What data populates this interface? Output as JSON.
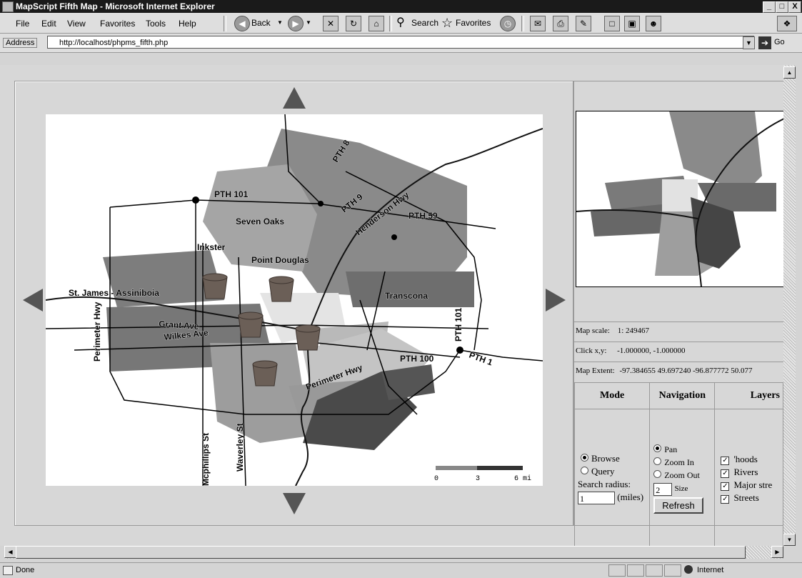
{
  "window": {
    "title": "MapScript Fifth Map - Microsoft Internet Explorer",
    "minimize": "_",
    "maximize": "□",
    "close": "X"
  },
  "menu": [
    "File",
    "Edit",
    "View",
    "Favorites",
    "Tools",
    "Help"
  ],
  "toolbar": {
    "back": "Back",
    "search": "Search",
    "favorites": "Favorites"
  },
  "address": {
    "label": "Address",
    "url": "http://localhost/phpms_fifth.php",
    "go": "Go"
  },
  "map": {
    "labels": {
      "pth101": "PTH 101",
      "pth8": "PTH 8",
      "pth9": "PTH 9",
      "henderson": "Henderson Hwy",
      "pth59": "PTH 59",
      "sevenoaks": "Seven Oaks",
      "inkster": "Inkster",
      "pointdouglas": "Point Douglas",
      "stjames": "St. James - Assiniboia",
      "transcona": "Transcona",
      "grant": "Grant Ave",
      "wilkes": "Wilkes Ave",
      "perimeter_w": "Perimeter Hwy",
      "pth101v": "PTH 101",
      "pth100": "PTH 100",
      "pth1": "PTH 1",
      "perimeter_s": "Perimeter Hwy",
      "mcphillips": "Mcphillips St",
      "waverley": "Waverley St"
    },
    "scalebar": {
      "ticks": [
        "0",
        "3",
        "6 mi"
      ]
    }
  },
  "info": {
    "scale_label": "Map scale:",
    "scale_value": "1: 249467",
    "click_label": "Click x,y:",
    "click_value": "-1.000000, -1.000000",
    "extent_label": "Map Extent:",
    "extent_value": "-97.384655 49.697240 -96.877772 50.077"
  },
  "controls": {
    "headers": {
      "mode": "Mode",
      "navigation": "Navigation",
      "layers": "Layers"
    },
    "mode": {
      "browse": "Browse",
      "query": "Query",
      "radius_label": "Search radius:",
      "radius_value": "1",
      "radius_unit": "(miles)"
    },
    "navigation": {
      "pan": "Pan",
      "zoomin": "Zoom In",
      "zoomout": "Zoom Out",
      "size_value": "2",
      "size_label": "Size",
      "refresh": "Refresh"
    },
    "layers": [
      "'hoods",
      "Rivers",
      "Major stre",
      "Streets"
    ]
  },
  "status": {
    "left": "Done",
    "zone": "Internet"
  }
}
